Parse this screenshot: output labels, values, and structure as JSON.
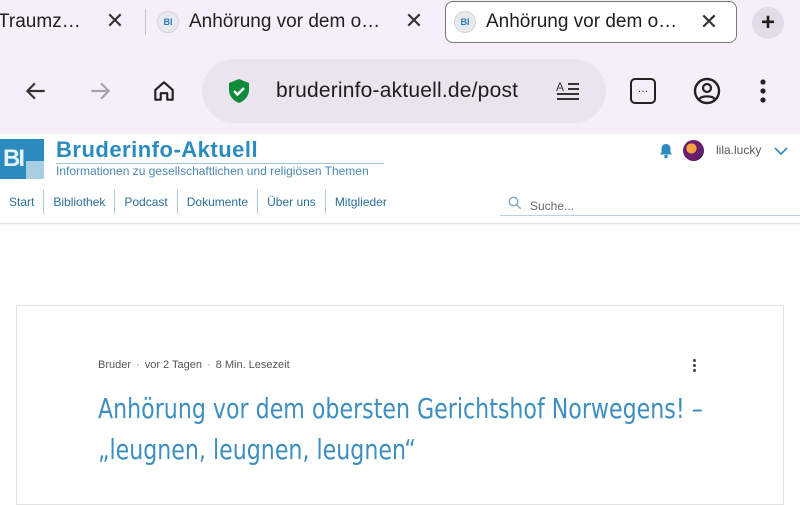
{
  "browser": {
    "tabs": [
      {
        "title": "Traumz…",
        "active": false
      },
      {
        "title": "Anhörung vor dem o…",
        "favicon": "BI",
        "active": false
      },
      {
        "title": "Anhörung vor dem o…",
        "favicon": "BI",
        "active": true
      }
    ],
    "url": "bruderinfo-aktuell.de/post",
    "icons": {
      "back": "arrow-left-icon",
      "forward": "arrow-right-icon",
      "home": "home-icon",
      "security": "shield-check-icon",
      "reader": "reader-mode-icon",
      "tabs": "tab-switcher-icon",
      "account": "account-icon",
      "menu": "more-vertical-icon"
    },
    "tab_switcher_label": "…",
    "colors": {
      "chrome_bg": "#f6effa",
      "omnibox": "#ebe3ee",
      "shield": "#0e8a3a"
    }
  },
  "site": {
    "logo_text": "BI",
    "title": "Bruderinfo-Aktuell",
    "tagline": "Informationen zu gesellschaftlichen und religiösen Themen",
    "username": "lila.lucky",
    "nav": [
      "Start",
      "Bibliothek",
      "Podcast",
      "Dokumente",
      "Über uns",
      "Mitglieder"
    ],
    "search_placeholder": "Suche...",
    "accent": "#2b8bbf"
  },
  "post": {
    "author": "Bruder",
    "sep": "·",
    "date": "vor 2 Tagen",
    "reading_time": "8 Min. Lesezeit",
    "title_line1": "Anhörung vor dem obersten Gerichtshof Norwegens! –",
    "title_line2": "„leugnen, leugnen, leugnen“"
  }
}
